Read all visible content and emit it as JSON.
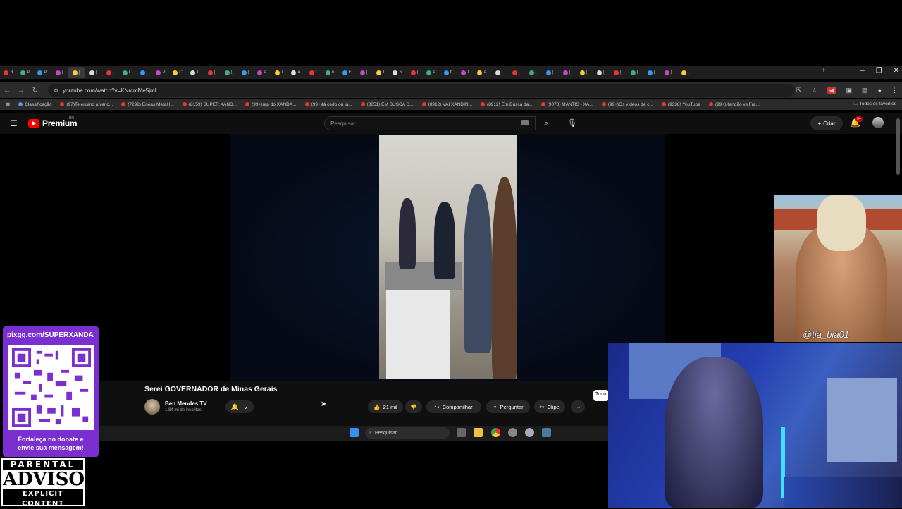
{
  "browser": {
    "tabs": [
      "B",
      "P",
      "P",
      "(",
      "[",
      "(",
      "(",
      "L",
      "(",
      "P",
      "C",
      "T",
      "(",
      "(",
      "(",
      "A",
      "T",
      "A",
      "r",
      "u",
      "F",
      "(",
      "T",
      "S",
      "(",
      "A",
      "h",
      "T",
      "A",
      "(",
      "(",
      "(",
      "(",
      "(",
      "(",
      "(",
      "(",
      "(",
      "(",
      "(",
      "("
    ],
    "url": "youtube.com/watch?v=KNrcmMe5jmI",
    "bookmarks": [
      "Classificação",
      "(97)Te ensino a venc...",
      "(7292) Enéas Metal |...",
      "(8159) SUPER XAND...",
      "(99+)rap do XANDÃ...",
      "(99+)tá cedo ou já...",
      "(8851) EM BUSCA D...",
      "(8912) VAI XANDIN...",
      "(8912) Em Busca da...",
      "(9078) MANTIS - XA...",
      "(99+)Os vídeos de c...",
      "(9338) YouTube",
      "(99+)Xandão vs Fra..."
    ],
    "bookmarks_all": "Todos os favoritos"
  },
  "youtube": {
    "logo": "Premium",
    "region": "BR",
    "search_placeholder": "Pesquisar",
    "create_label": "Criar",
    "notif_badge": "9+",
    "video_title": "Serei GOVERNADOR de Minas Gerais",
    "channel_name": "Ben Mendes TV",
    "channel_subs": "1,84 mi de inscritos",
    "likes": "21 mil",
    "share_label": "Compartilhar",
    "ask_label": "Perguntar",
    "clip_label": "Clipe",
    "todos_label": "Todo"
  },
  "taskbar": {
    "search_placeholder": "Pesquisar"
  },
  "overlay": {
    "qr_url": "pixgg.com/SUPERXANDA",
    "qr_msg1": "Fortaleça no donate e",
    "qr_msg2": "envie sua mensagem!",
    "pa_top": "PARENTAL",
    "pa_mid": "ADVISORY",
    "pa_bot": "EXPLICIT CONTENT",
    "muscle_tag": "@tia_bia01"
  },
  "colors": {
    "yt_red": "#ff0000",
    "qr_purple": "#7b2fd1"
  }
}
